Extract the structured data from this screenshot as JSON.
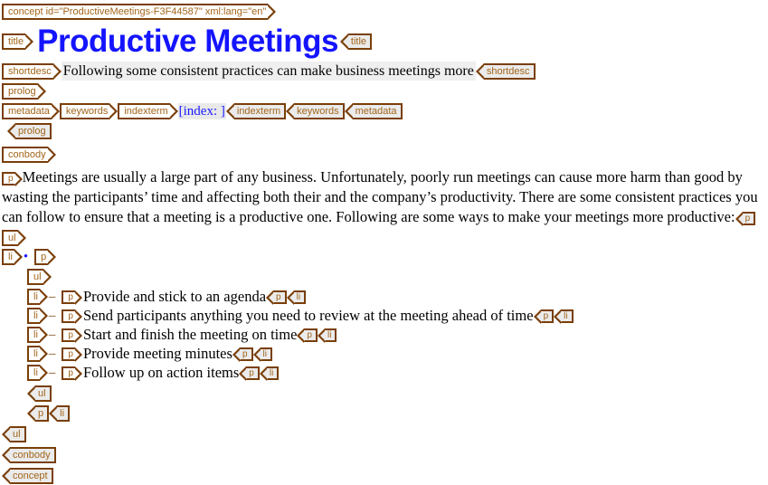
{
  "document": {
    "root_tag": "concept id=\"ProductiveMeetings-F3F44587\" xml:lang=\"en\"",
    "root_tag_close": "concept",
    "title": {
      "tag": "title",
      "text": "Productive Meetings",
      "color": "#1414ff"
    },
    "shortdesc": {
      "tag": "shortdesc",
      "text": "Following some consistent practices can make business meetings more"
    },
    "prolog": {
      "tag": "prolog",
      "metadata_tag": "metadata",
      "keywords_tag": "keywords",
      "indexterm_tag": "indexterm",
      "indexterm_text": "[index: ]"
    },
    "conbody": {
      "tag": "conbody",
      "p_tag": "p",
      "intro_paragraph": "Meetings are usually a large part of any business. Unfortunately, poorly run meetings can cause more harm than good by wasting the participants’ time and affecting both their and the company’s productivity. There are some consistent practices you can follow to ensure that a meeting is a productive one. Following are some ways to make your meetings more productive:",
      "ul_tag": "ul",
      "li_tag": "li",
      "outer_bullet": "•",
      "inner_marker": "–",
      "items": [
        {
          "text": "Provide and stick to an agenda"
        },
        {
          "text": "Send participants anything you need to review at the meeting ahead of time"
        },
        {
          "text": "Start and finish the meeting on time"
        },
        {
          "text": "Provide meeting minutes"
        },
        {
          "text": "Follow up on action items"
        }
      ]
    }
  },
  "theme": {
    "tag_border": "#7a3f09",
    "tag_text": "#a2651b",
    "tag_close_fill": "#ebebeb",
    "highlight_bg": "#efefef",
    "link_blue": "#1a1aff"
  }
}
